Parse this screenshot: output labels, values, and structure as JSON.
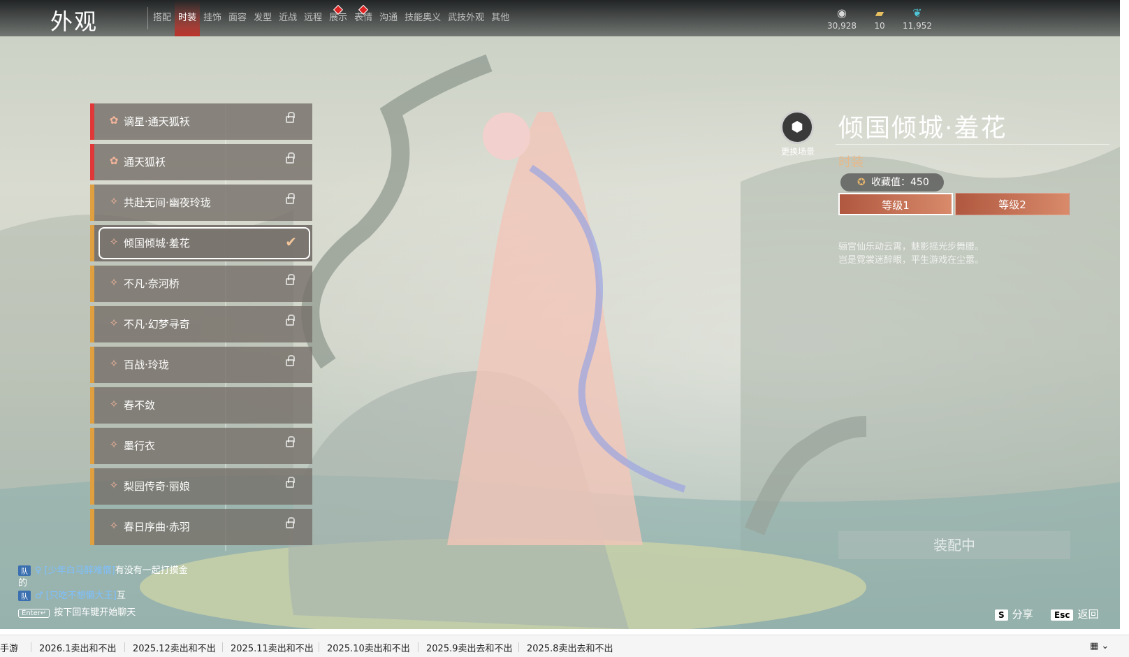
{
  "header": {
    "title": "外观",
    "tabs": [
      {
        "label": "搭配"
      },
      {
        "label": "时装"
      },
      {
        "label": "挂饰"
      },
      {
        "label": "面容"
      },
      {
        "label": "发型"
      },
      {
        "label": "近战"
      },
      {
        "label": "远程"
      },
      {
        "label": "展示"
      },
      {
        "label": "表情"
      },
      {
        "label": "沟通"
      },
      {
        "label": "技能奥义"
      },
      {
        "label": "武技外观"
      },
      {
        "label": "其他"
      }
    ],
    "active_tab": "时装",
    "currencies": [
      {
        "icon": "jade-coin-icon",
        "value": "30,928"
      },
      {
        "icon": "ticket-icon",
        "value": "10"
      },
      {
        "icon": "feather-icon",
        "value": "11,952"
      }
    ]
  },
  "outfit_list": {
    "items": [
      {
        "label": "谪星·通天狐袄",
        "rarity": "red",
        "locked": true
      },
      {
        "label": "通天狐袄",
        "rarity": "red",
        "locked": true
      },
      {
        "label": "共赴无间·幽夜玲珑",
        "rarity": "gold",
        "locked": true
      },
      {
        "label": "倾国倾城·羞花",
        "rarity": "gold",
        "selected": true
      },
      {
        "label": "不凡·奈河桥",
        "rarity": "gold",
        "locked": true
      },
      {
        "label": "不凡·幻梦寻奇",
        "rarity": "gold",
        "locked": true
      },
      {
        "label": "百战·玲珑",
        "rarity": "gold",
        "locked": true
      },
      {
        "label": "春不敛",
        "rarity": "gold",
        "locked": false
      },
      {
        "label": "墨行衣",
        "rarity": "gold",
        "locked": true
      },
      {
        "label": "梨园传奇·丽娘",
        "rarity": "gold",
        "locked": true
      },
      {
        "label": "春日序曲·赤羽",
        "rarity": "gold",
        "locked": true
      }
    ]
  },
  "detail": {
    "scene_button_label": "更换场景",
    "title": "倾国倾城·羞花",
    "type": "时装",
    "collect_value": "收藏值：450",
    "levels": [
      "等级1",
      "等级2"
    ],
    "description": [
      "骊宫仙乐动云霄，魅影摇光步舞腰。",
      "岂是霓裳迷醉眼，平生游戏在尘嚣。"
    ],
    "equip_label": "装配中"
  },
  "chat": {
    "lines": [
      {
        "channel": "队",
        "gender": "♀",
        "name": "[少年白马醉难惰]",
        "text": "有没有一起打摸金"
      },
      {
        "text": "的"
      },
      {
        "channel": "队",
        "gender": "♂",
        "name": "[只吃不想懒大王]",
        "text": "互"
      }
    ],
    "enter_key": "Enter↵",
    "enter_hint": "按下回车键开始聊天"
  },
  "hotkeys": {
    "share_key": "S",
    "share_label": "分享",
    "back_key": "Esc",
    "back_label": "返回"
  },
  "taskbar": {
    "items": [
      "手游",
      "2026.1卖出和不出",
      "2025.12卖出和不出",
      "2025.11卖出和不出",
      "2025.10卖出和不出",
      "2025.9卖出去和不出",
      "2025.8卖出去和不出"
    ]
  },
  "colors": {
    "accent_red": "#d22",
    "rarity_red": "#e03838",
    "rarity_gold": "#e0a040",
    "level_bar": "#c87056"
  }
}
